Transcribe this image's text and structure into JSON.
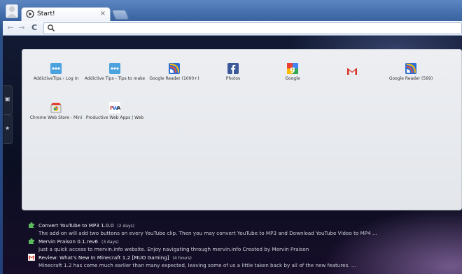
{
  "tab": {
    "title": "Start!"
  },
  "tab_close": "×",
  "nav": {
    "back": "←",
    "forward": "→",
    "reload": "C"
  },
  "side_tabs": [
    "▣",
    "★"
  ],
  "shortcuts": [
    {
      "label": "AddictiveTips › Log In",
      "icon": "dots-blue-icon"
    },
    {
      "label": "Addictive Tips - Tips to make",
      "icon": "dots-blue-icon"
    },
    {
      "label": "Google Reader (1000+)",
      "icon": "google-reader-icon"
    },
    {
      "label": "Photos",
      "icon": "facebook-icon"
    },
    {
      "label": "Google",
      "icon": "google-icon"
    },
    {
      "label": "",
      "icon": "gmail-icon"
    },
    {
      "label": "Google Reader (569)",
      "icon": "google-reader-icon"
    },
    {
      "label": "Chrome Web Store - Mini",
      "icon": "chrome-web-store-icon"
    },
    {
      "label": "Productive Web Apps | Web",
      "icon": "pwa-icon"
    }
  ],
  "feed": [
    {
      "icon": "puzzle-icon",
      "title": "Convert YouTube to MP3 1.0.0",
      "age": "(2 days)",
      "desc": "The add-on will add two buttons on every YouTube clip. Then you may convert YouTube to MP3 and Download YouTube Video to MP4 ..."
    },
    {
      "icon": "puzzle-icon",
      "title": "Mervin Praison 0.1.rev6",
      "age": "(3 days)",
      "desc": "Just a quick access to mervin.info website. Enjoy navigating through mervin.info Created by Mervin Praison"
    },
    {
      "icon": "gmail-small-icon",
      "title": "Review: What's New In Minecraft 1.2 [MUO Gaming]",
      "age": "(4 hours)",
      "desc": "Minecraft 1.2 has come much earlier than many expected, leaving some of us a little taken back by all of the new features. ..."
    }
  ],
  "colors": {
    "panel": "#e6e8ec",
    "frame": "#3f6aa8",
    "background": "#0b0f22"
  }
}
